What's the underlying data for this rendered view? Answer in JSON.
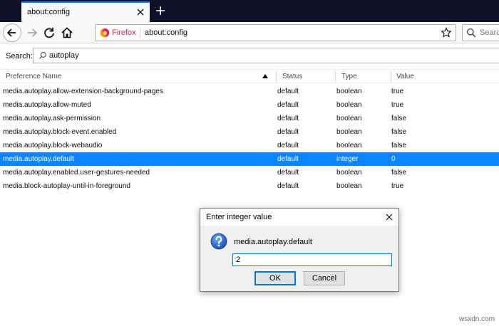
{
  "tab": {
    "title": "about:config"
  },
  "urlbar": {
    "identity_label": "Firefox",
    "url": "about:config"
  },
  "searchbar": {
    "placeholder": "Searc"
  },
  "config_search": {
    "label": "Search:",
    "value": "autoplay"
  },
  "table": {
    "columns": [
      "Preference Name",
      "Status",
      "Type",
      "Value"
    ],
    "rows": [
      {
        "name": "media.autoplay.allow-extension-background-pages",
        "status": "default",
        "type": "boolean",
        "value": "true"
      },
      {
        "name": "media.autoplay.allow-muted",
        "status": "default",
        "type": "boolean",
        "value": "true"
      },
      {
        "name": "media.autoplay.ask-permission",
        "status": "default",
        "type": "boolean",
        "value": "false"
      },
      {
        "name": "media.autoplay.block-event.enabled",
        "status": "default",
        "type": "boolean",
        "value": "false"
      },
      {
        "name": "media.autoplay.block-webaudio",
        "status": "default",
        "type": "boolean",
        "value": "false"
      },
      {
        "name": "media.autoplay.default",
        "status": "default",
        "type": "integer",
        "value": "0",
        "selected": true
      },
      {
        "name": "media.autoplay.enabled.user-gestures-needed",
        "status": "default",
        "type": "boolean",
        "value": "false"
      },
      {
        "name": "media.block-autoplay-until-in-foreground",
        "status": "default",
        "type": "boolean",
        "value": "true"
      }
    ]
  },
  "dialog": {
    "title": "Enter integer value",
    "message": "media.autoplay.default",
    "input_value": "2",
    "ok_label": "OK",
    "cancel_label": "Cancel"
  },
  "watermark": "wsxdn.com",
  "colors": {
    "accent": "#0a84ff",
    "tabstrip": "#0f1126",
    "firefox_label": "#d7264a"
  }
}
